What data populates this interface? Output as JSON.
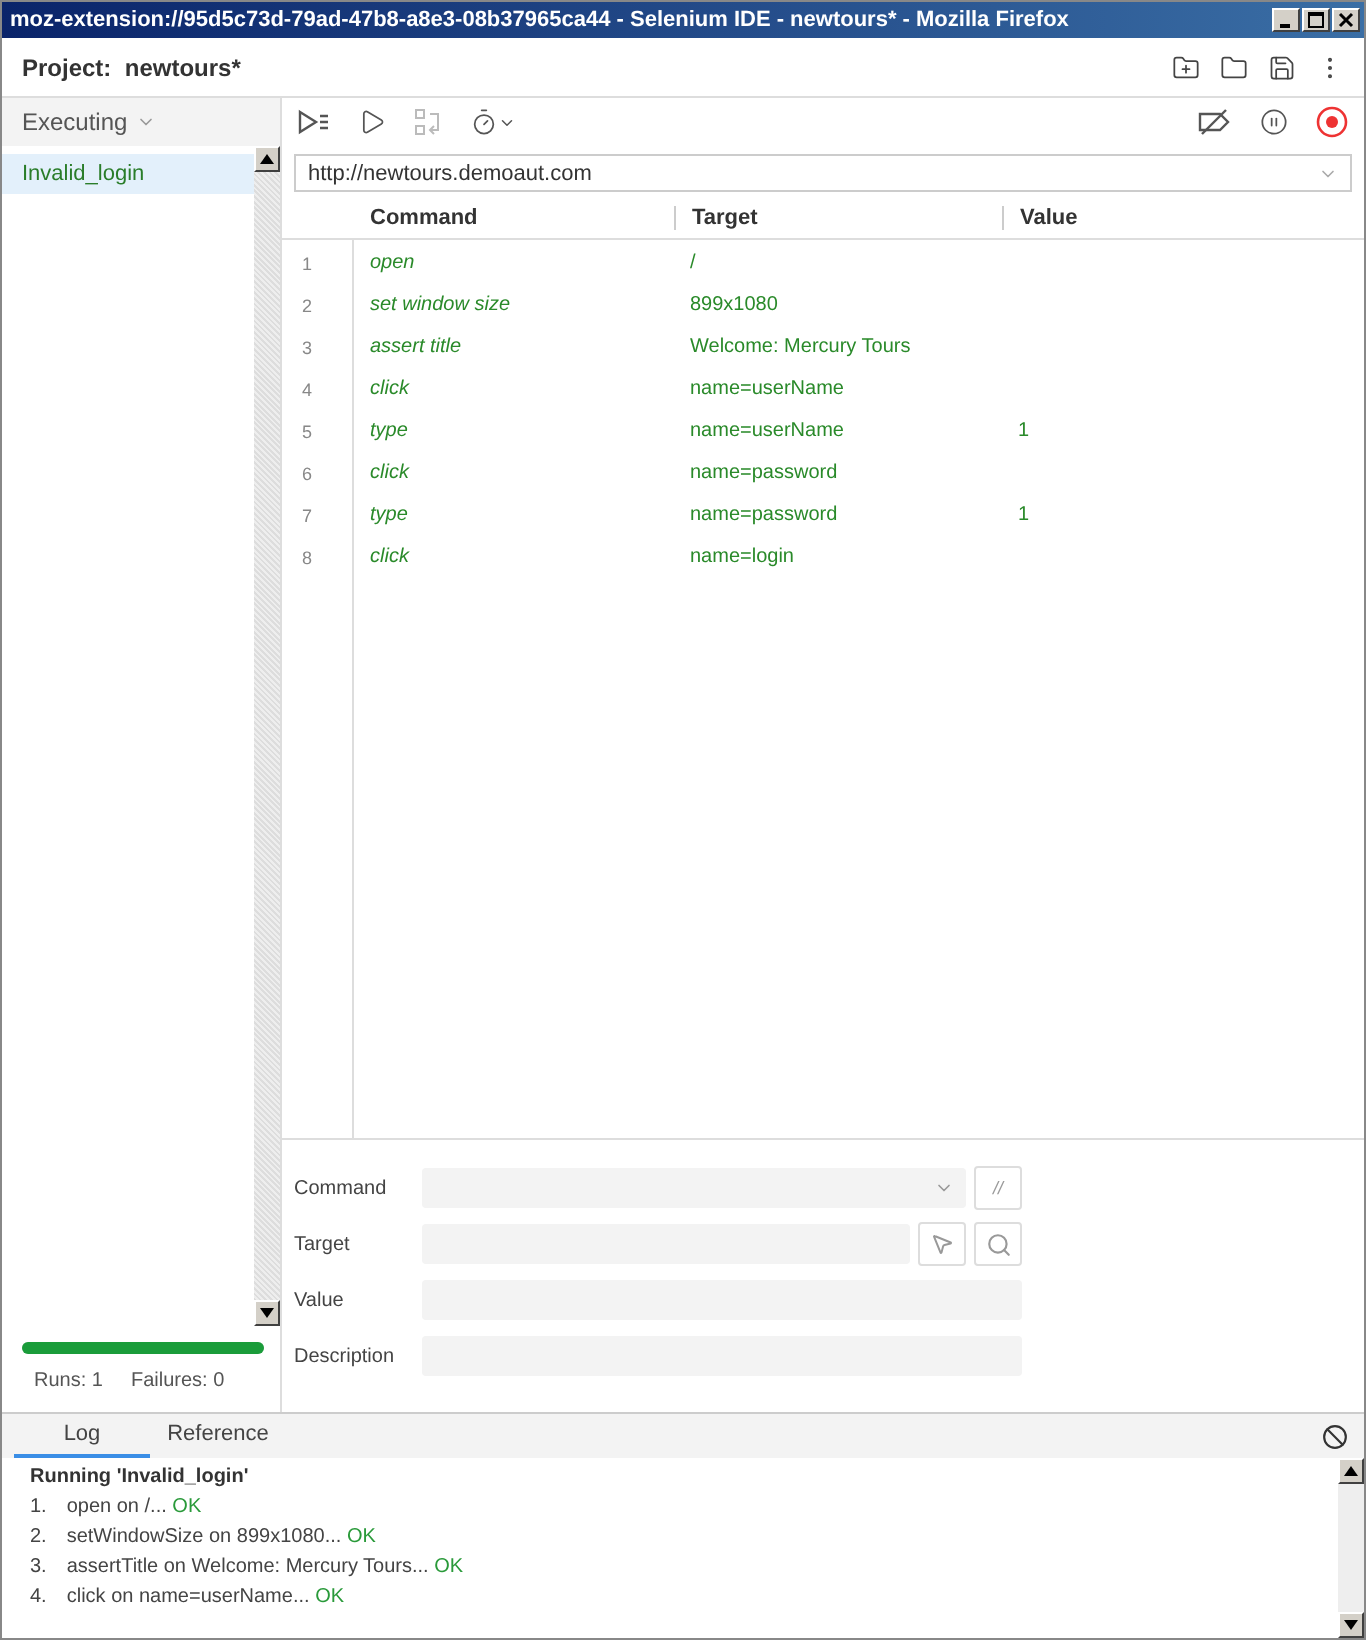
{
  "window": {
    "title": "moz-extension://95d5c73d-79ad-47b8-a8e3-08b37965ca44 - Selenium IDE - newtours* - Mozilla Firefox"
  },
  "project": {
    "label": "Project:",
    "name": "newtours*"
  },
  "sidebar": {
    "dropdown": "Executing",
    "tests": [
      {
        "name": "Invalid_login",
        "selected": true
      }
    ],
    "progress": {
      "level": 1
    },
    "runs": "Runs: 1",
    "failures": "Failures: 0"
  },
  "url": "http://newtours.demoaut.com",
  "table": {
    "columns": [
      "Command",
      "Target",
      "Value"
    ],
    "rows": [
      {
        "num": "1",
        "command": "open",
        "target": "/",
        "value": ""
      },
      {
        "num": "2",
        "command": "set window size",
        "target": "899x1080",
        "value": ""
      },
      {
        "num": "3",
        "command": "assert title",
        "target": "Welcome: Mercury Tours",
        "value": ""
      },
      {
        "num": "4",
        "command": "click",
        "target": "name=userName",
        "value": ""
      },
      {
        "num": "5",
        "command": "type",
        "target": "name=userName",
        "value": "1"
      },
      {
        "num": "6",
        "command": "click",
        "target": "name=password",
        "value": ""
      },
      {
        "num": "7",
        "command": "type",
        "target": "name=password",
        "value": "1"
      },
      {
        "num": "8",
        "command": "click",
        "target": "name=login",
        "value": ""
      }
    ]
  },
  "editor": {
    "fields": [
      {
        "label": "Command",
        "kind": "select"
      },
      {
        "label": "Target",
        "kind": "target"
      },
      {
        "label": "Value",
        "kind": "text"
      },
      {
        "label": "Description",
        "kind": "text"
      }
    ],
    "comment_button": "//"
  },
  "log": {
    "tabs": [
      {
        "label": "Log",
        "selected": true
      },
      {
        "label": "Reference",
        "selected": false
      }
    ],
    "heading": "Running 'Invalid_login'",
    "entries": [
      {
        "num": "1.",
        "text": "open on /...",
        "status": "OK"
      },
      {
        "num": "2.",
        "text": "setWindowSize on 899x1080...",
        "status": "OK"
      },
      {
        "num": "3.",
        "text": "assertTitle on Welcome: Mercury Tours...",
        "status": "OK"
      },
      {
        "num": "4.",
        "text": "click on name=userName...",
        "status": "OK"
      }
    ]
  }
}
